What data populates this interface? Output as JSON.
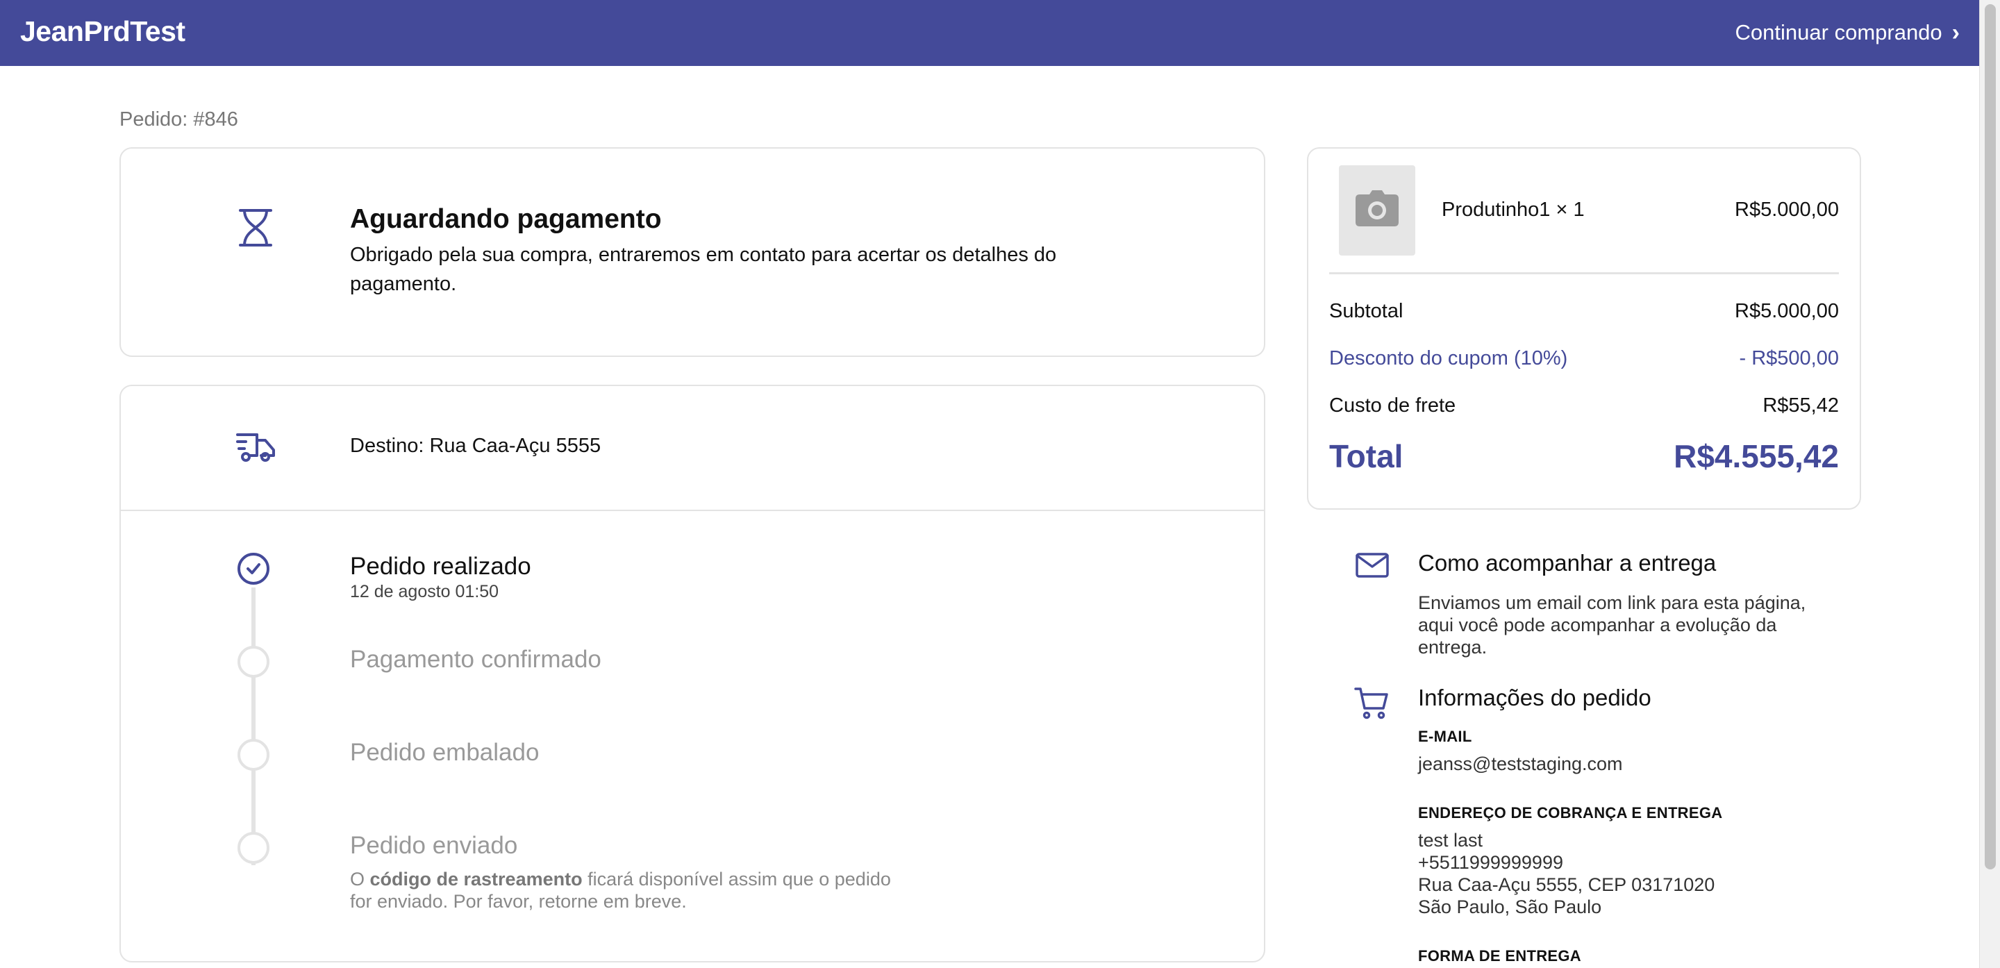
{
  "header": {
    "brand": "JeanPrdTest",
    "continue_label": "Continuar comprando",
    "brand_color": "#444a99"
  },
  "order": {
    "label": "Pedido: #846"
  },
  "status": {
    "title": "Aguardando pagamento",
    "description": "Obrigado pela sua compra, entraremos em contato para acertar os detalhes do pagamento.",
    "icon": "hourglass-icon"
  },
  "shipping": {
    "destination": "Destino: Rua Caa-Açu 5555",
    "icon": "truck-icon",
    "timeline": [
      {
        "title": "Pedido realizado",
        "date": "12 de agosto 01:50",
        "done": true
      },
      {
        "title": "Pagamento confirmado",
        "done": false
      },
      {
        "title": "Pedido embalado",
        "done": false
      },
      {
        "title": "Pedido enviado",
        "done": false
      }
    ],
    "note_prefix": "O ",
    "note_bold": "código de rastreamento",
    "note_suffix": " ficará disponível assim que o pedido for enviado. Por favor, retorne em breve."
  },
  "summary": {
    "product": {
      "name": "Produtinho1 × 1",
      "price": "R$5.000,00",
      "image_icon": "camera-icon"
    },
    "subtotal_label": "Subtotal",
    "subtotal_value": "R$5.000,00",
    "discount_label": "Desconto do cupom (10%)",
    "discount_value": "- R$500,00",
    "shipping_label": "Custo de frete",
    "shipping_value": "R$55,42",
    "total_label": "Total",
    "total_value": "R$4.555,42"
  },
  "tracking_info": {
    "title": "Como acompanhar a entrega",
    "description": "Enviamos um email com link para esta página, aqui você pode acompanhar a evolução da entrega.",
    "icon": "mail-icon"
  },
  "order_info": {
    "title": "Informações do pedido",
    "icon": "cart-icon",
    "email_label": "E-MAIL",
    "email": "jeanss@teststaging.com",
    "address_label": "ENDEREÇO DE COBRANÇA E ENTREGA",
    "address_lines": [
      "test last",
      "+5511999999999",
      "Rua Caa-Açu 5555, CEP 03171020",
      "São Paulo, São Paulo"
    ],
    "delivery_label": "FORMA DE ENTREGA"
  }
}
